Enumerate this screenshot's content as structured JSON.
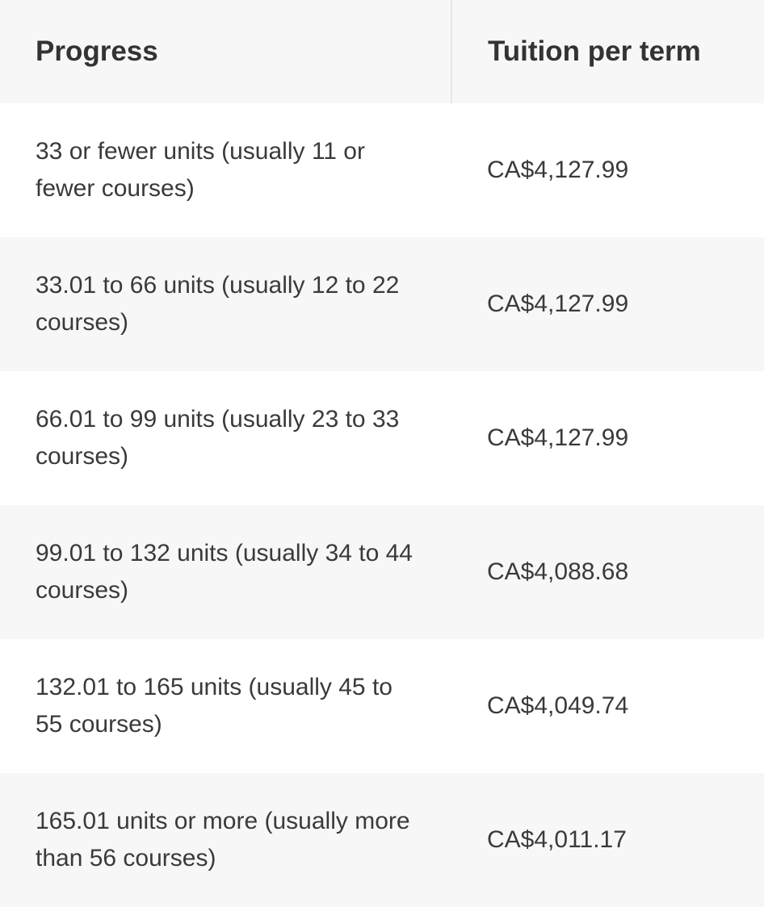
{
  "table": {
    "headers": {
      "progress": "Progress",
      "tuition": "Tuition per term"
    },
    "rows": [
      {
        "progress": "33 or fewer units (usually 11 or fewer courses)",
        "tuition": "CA$4,127.99"
      },
      {
        "progress": "33.01 to 66 units (usually 12 to 22 courses)",
        "tuition": "CA$4,127.99"
      },
      {
        "progress": "66.01 to 99 units (usually 23 to 33 courses)",
        "tuition": "CA$4,127.99"
      },
      {
        "progress": "99.01 to 132 units (usually 34 to 44 courses)",
        "tuition": "CA$4,088.68"
      },
      {
        "progress": "132.01 to 165 units (usually 45 to 55 courses)",
        "tuition": "CA$4,049.74"
      },
      {
        "progress": "165.01 units or more (usually more than 56 courses)",
        "tuition": "CA$4,011.17"
      }
    ]
  }
}
